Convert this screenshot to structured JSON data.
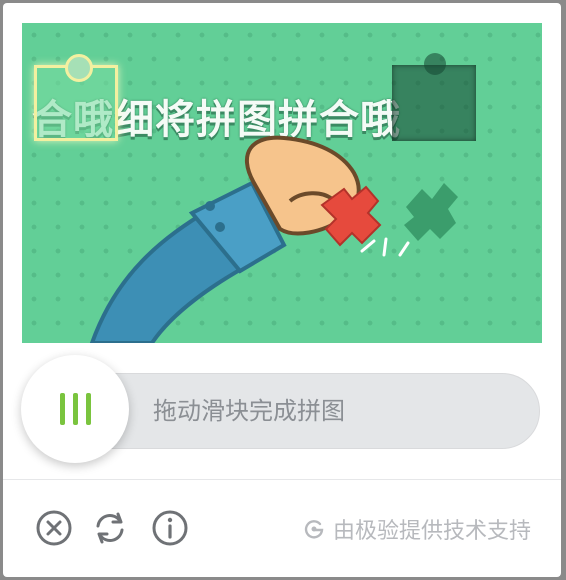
{
  "captcha": {
    "banner_text": "合哦细将拼图拼合哦",
    "slider_hint": "拖动滑块完成拼图",
    "brand_text": "由极验提供技术支持"
  },
  "icons": {
    "close": "close-circle-icon",
    "refresh": "refresh-icon",
    "info": "info-icon",
    "brand": "geetest-logo-icon",
    "handle": "grip-lines-icon"
  },
  "colors": {
    "image_bg": "#62cf97",
    "handle_grip": "#7ac43e",
    "track_bg": "#e4e6e8",
    "hint_text": "#8b8f94",
    "brand_text": "#b7b9bd",
    "icon": "#6f7276"
  }
}
